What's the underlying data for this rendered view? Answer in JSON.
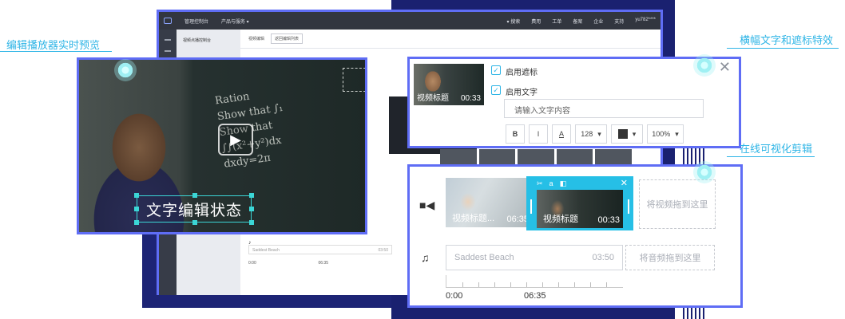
{
  "callouts": {
    "player_preview": "编辑播放器实时预览",
    "overlay_effects": "横幅文字和遮标特效",
    "timeline_editing": "在线可视化剪辑"
  },
  "console": {
    "top_title": "管理控制台",
    "top_menu": "产品与服务 ▾",
    "top_right": [
      "▾ 搜索",
      "费用",
      "工单",
      "备案",
      "企业",
      "支持",
      "yu782****"
    ],
    "nav_title": "视频点播控制台",
    "toolbar_title": "视频编辑",
    "toolbar_back": "返回编辑列表",
    "music_note": "♪",
    "audio_track": {
      "name": "Saddest Beach",
      "duration": "03:50"
    },
    "ruler": [
      "0:00",
      "06:35"
    ]
  },
  "player": {
    "play_icon": "play-icon",
    "text_edit": "文字编辑状态",
    "board_text": [
      "Ration",
      "Show that ∫₁",
      "Show that",
      "∫∫(x²+y²)dx",
      "dxdy=2π"
    ]
  },
  "overlay": {
    "thumb_title": "视频标题",
    "thumb_time": "00:33",
    "enable_mask": "启用遮标",
    "enable_text": "启用文字",
    "text_placeholder": "请输入文字内容",
    "bold": "B",
    "italic": "I",
    "font_color": "A",
    "font_size": "128",
    "opacity": "100%",
    "close": "✕"
  },
  "timeline": {
    "video_clip_label": "视频标题...",
    "video_clip_time": "06:35",
    "selected_clip_label": "视频标题",
    "selected_clip_time": "00:33",
    "clip_tools": [
      "✂",
      "a",
      "◧"
    ],
    "clip_close": "✕",
    "drop_video": "将视频拖到这里",
    "audio_name": "Saddest Beach",
    "audio_time": "03:50",
    "drop_audio": "将音频拖到这里",
    "ruler_start": "0:00",
    "ruler_mid": "06:35"
  },
  "colors": {
    "accent": "#5f6df5",
    "highlight": "#26bfe6",
    "navy": "#1d2475"
  }
}
